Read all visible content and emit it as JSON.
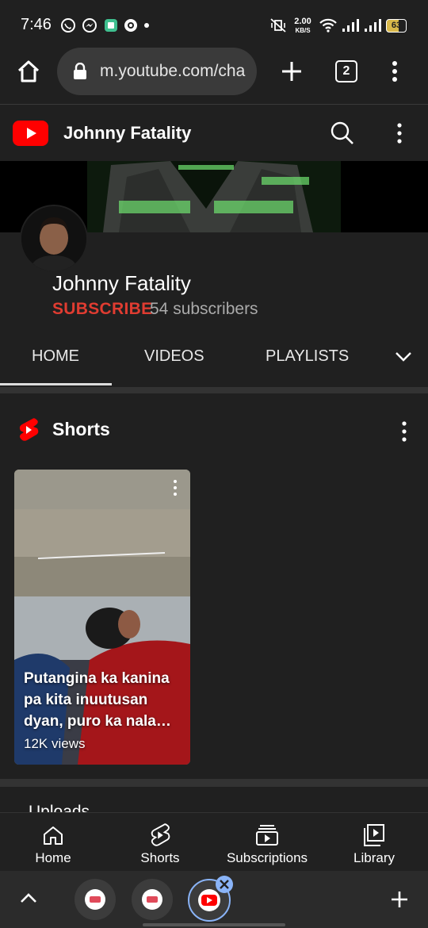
{
  "status": {
    "time": "7:46",
    "net_speed": "2.00",
    "net_unit": "KB/S",
    "battery": "63"
  },
  "browser": {
    "url": "m.youtube.com/cha",
    "tab_count": "2"
  },
  "yt_header": {
    "channel_title": "Johnny Fatality"
  },
  "channel": {
    "name": "Johnny Fatality",
    "subscribe_label": "SUBSCRIBE",
    "subscriber_count": "54 subscribers"
  },
  "tabs": [
    {
      "label": "HOME"
    },
    {
      "label": "VIDEOS"
    },
    {
      "label": "PLAYLISTS"
    }
  ],
  "shorts": {
    "section_title": "Shorts",
    "items": [
      {
        "title": "Putangina ka kanina pa kita inuutusan dyan, puro ka nala…",
        "views": "12K views"
      }
    ]
  },
  "uploads": {
    "section_title": "Uploads"
  },
  "bottom_nav": [
    {
      "label": "Home"
    },
    {
      "label": "Shorts"
    },
    {
      "label": "Subscriptions"
    },
    {
      "label": "Library"
    }
  ],
  "colors": {
    "yt_red": "#ff0000",
    "subscribe_red": "#e03c31",
    "background": "#202020"
  }
}
